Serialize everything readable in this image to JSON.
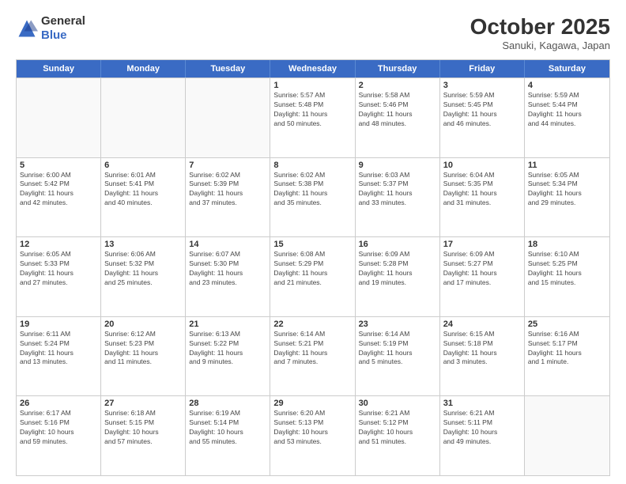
{
  "header": {
    "logo_general": "General",
    "logo_blue": "Blue",
    "month": "October 2025",
    "location": "Sanuki, Kagawa, Japan"
  },
  "weekdays": [
    "Sunday",
    "Monday",
    "Tuesday",
    "Wednesday",
    "Thursday",
    "Friday",
    "Saturday"
  ],
  "rows": [
    [
      {
        "day": "",
        "info": ""
      },
      {
        "day": "",
        "info": ""
      },
      {
        "day": "",
        "info": ""
      },
      {
        "day": "1",
        "info": "Sunrise: 5:57 AM\nSunset: 5:48 PM\nDaylight: 11 hours\nand 50 minutes."
      },
      {
        "day": "2",
        "info": "Sunrise: 5:58 AM\nSunset: 5:46 PM\nDaylight: 11 hours\nand 48 minutes."
      },
      {
        "day": "3",
        "info": "Sunrise: 5:59 AM\nSunset: 5:45 PM\nDaylight: 11 hours\nand 46 minutes."
      },
      {
        "day": "4",
        "info": "Sunrise: 5:59 AM\nSunset: 5:44 PM\nDaylight: 11 hours\nand 44 minutes."
      }
    ],
    [
      {
        "day": "5",
        "info": "Sunrise: 6:00 AM\nSunset: 5:42 PM\nDaylight: 11 hours\nand 42 minutes."
      },
      {
        "day": "6",
        "info": "Sunrise: 6:01 AM\nSunset: 5:41 PM\nDaylight: 11 hours\nand 40 minutes."
      },
      {
        "day": "7",
        "info": "Sunrise: 6:02 AM\nSunset: 5:39 PM\nDaylight: 11 hours\nand 37 minutes."
      },
      {
        "day": "8",
        "info": "Sunrise: 6:02 AM\nSunset: 5:38 PM\nDaylight: 11 hours\nand 35 minutes."
      },
      {
        "day": "9",
        "info": "Sunrise: 6:03 AM\nSunset: 5:37 PM\nDaylight: 11 hours\nand 33 minutes."
      },
      {
        "day": "10",
        "info": "Sunrise: 6:04 AM\nSunset: 5:35 PM\nDaylight: 11 hours\nand 31 minutes."
      },
      {
        "day": "11",
        "info": "Sunrise: 6:05 AM\nSunset: 5:34 PM\nDaylight: 11 hours\nand 29 minutes."
      }
    ],
    [
      {
        "day": "12",
        "info": "Sunrise: 6:05 AM\nSunset: 5:33 PM\nDaylight: 11 hours\nand 27 minutes."
      },
      {
        "day": "13",
        "info": "Sunrise: 6:06 AM\nSunset: 5:32 PM\nDaylight: 11 hours\nand 25 minutes."
      },
      {
        "day": "14",
        "info": "Sunrise: 6:07 AM\nSunset: 5:30 PM\nDaylight: 11 hours\nand 23 minutes."
      },
      {
        "day": "15",
        "info": "Sunrise: 6:08 AM\nSunset: 5:29 PM\nDaylight: 11 hours\nand 21 minutes."
      },
      {
        "day": "16",
        "info": "Sunrise: 6:09 AM\nSunset: 5:28 PM\nDaylight: 11 hours\nand 19 minutes."
      },
      {
        "day": "17",
        "info": "Sunrise: 6:09 AM\nSunset: 5:27 PM\nDaylight: 11 hours\nand 17 minutes."
      },
      {
        "day": "18",
        "info": "Sunrise: 6:10 AM\nSunset: 5:25 PM\nDaylight: 11 hours\nand 15 minutes."
      }
    ],
    [
      {
        "day": "19",
        "info": "Sunrise: 6:11 AM\nSunset: 5:24 PM\nDaylight: 11 hours\nand 13 minutes."
      },
      {
        "day": "20",
        "info": "Sunrise: 6:12 AM\nSunset: 5:23 PM\nDaylight: 11 hours\nand 11 minutes."
      },
      {
        "day": "21",
        "info": "Sunrise: 6:13 AM\nSunset: 5:22 PM\nDaylight: 11 hours\nand 9 minutes."
      },
      {
        "day": "22",
        "info": "Sunrise: 6:14 AM\nSunset: 5:21 PM\nDaylight: 11 hours\nand 7 minutes."
      },
      {
        "day": "23",
        "info": "Sunrise: 6:14 AM\nSunset: 5:19 PM\nDaylight: 11 hours\nand 5 minutes."
      },
      {
        "day": "24",
        "info": "Sunrise: 6:15 AM\nSunset: 5:18 PM\nDaylight: 11 hours\nand 3 minutes."
      },
      {
        "day": "25",
        "info": "Sunrise: 6:16 AM\nSunset: 5:17 PM\nDaylight: 11 hours\nand 1 minute."
      }
    ],
    [
      {
        "day": "26",
        "info": "Sunrise: 6:17 AM\nSunset: 5:16 PM\nDaylight: 10 hours\nand 59 minutes."
      },
      {
        "day": "27",
        "info": "Sunrise: 6:18 AM\nSunset: 5:15 PM\nDaylight: 10 hours\nand 57 minutes."
      },
      {
        "day": "28",
        "info": "Sunrise: 6:19 AM\nSunset: 5:14 PM\nDaylight: 10 hours\nand 55 minutes."
      },
      {
        "day": "29",
        "info": "Sunrise: 6:20 AM\nSunset: 5:13 PM\nDaylight: 10 hours\nand 53 minutes."
      },
      {
        "day": "30",
        "info": "Sunrise: 6:21 AM\nSunset: 5:12 PM\nDaylight: 10 hours\nand 51 minutes."
      },
      {
        "day": "31",
        "info": "Sunrise: 6:21 AM\nSunset: 5:11 PM\nDaylight: 10 hours\nand 49 minutes."
      },
      {
        "day": "",
        "info": ""
      }
    ]
  ]
}
